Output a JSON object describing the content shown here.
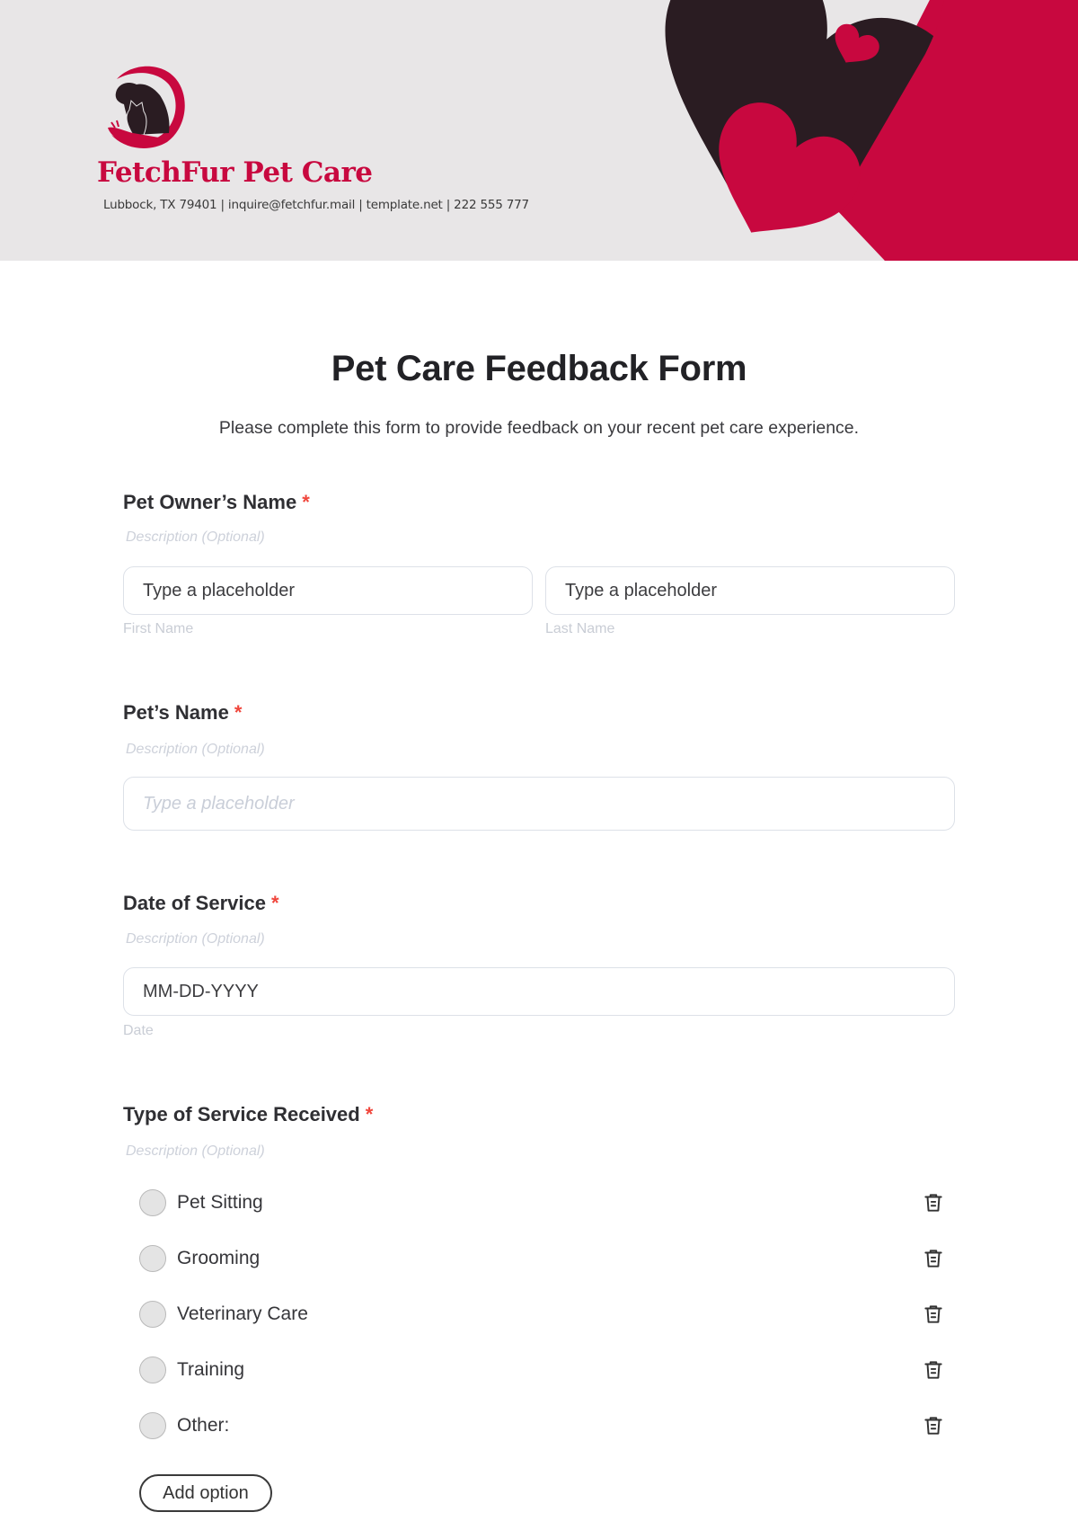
{
  "header": {
    "brand_name": "FetchFur Pet Care",
    "contact_line": "Lubbock, TX 79401 | inquire@fetchfur.mail | template.net | 222 555 777",
    "colors": {
      "accent": "#c8083f",
      "dark": "#2a1c22",
      "background": "#e8e6e7"
    }
  },
  "form": {
    "title": "Pet Care Feedback Form",
    "subtitle": "Please complete this form to provide feedback on your recent pet care experience.",
    "required_marker": "*",
    "questions": [
      {
        "label": "Pet Owner’s Name",
        "description": "Description (Optional)",
        "fields": [
          {
            "value": "Type a placeholder",
            "caption": "First Name"
          },
          {
            "value": "Type a placeholder",
            "caption": "Last Name"
          }
        ]
      },
      {
        "label": "Pet’s Name",
        "description": "Description (Optional)",
        "placeholder": "Type a placeholder"
      },
      {
        "label": "Date of Service",
        "description": "Description (Optional)",
        "value": "MM-DD-YYYY",
        "caption": "Date"
      },
      {
        "label": "Type of Service Received",
        "description": "Description (Optional)",
        "options": [
          {
            "label": "Pet Sitting",
            "icon": "trash-icon"
          },
          {
            "label": "Grooming",
            "icon": "trash-icon"
          },
          {
            "label": "Veterinary Care",
            "icon": "trash-icon"
          },
          {
            "label": "Training",
            "icon": "trash-icon"
          },
          {
            "label": "Other:",
            "icon": "trash-icon"
          }
        ],
        "add_option_label": "Add option"
      }
    ]
  }
}
